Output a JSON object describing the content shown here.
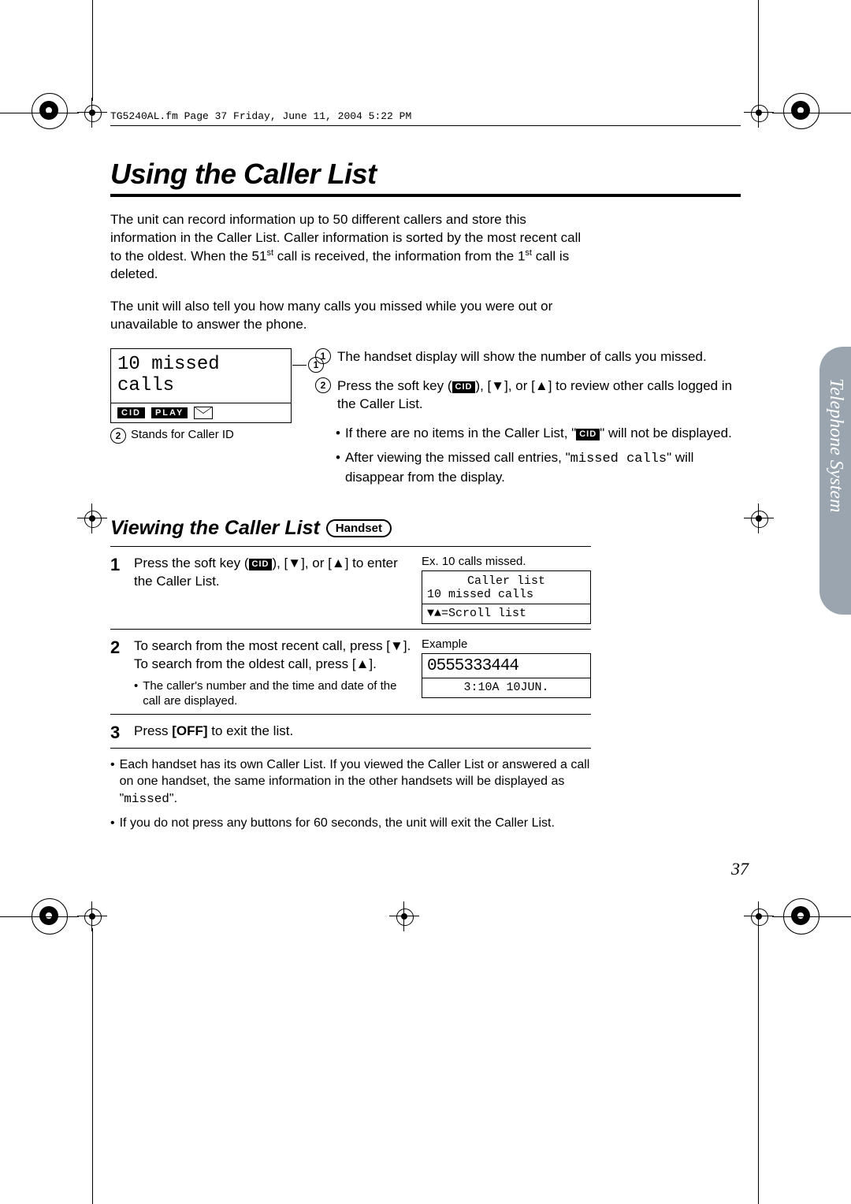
{
  "header": "TG5240AL.fm  Page 37  Friday, June 11, 2004  5:22 PM",
  "title": "Using the Caller List",
  "intro1_a": "The unit can record information up to 50 different callers and store this information in the Caller List. Caller information is sorted by the most recent call to the oldest. When the 51",
  "intro1_sup": "st",
  "intro1_b": " call is received, the information from the 1",
  "intro1_sup2": "st",
  "intro1_c": " call is deleted.",
  "intro2": "The unit will also tell you how many calls you missed while you were out or unavailable to answer the phone.",
  "lcd_top": "10 missed calls",
  "pill_cid": "CID",
  "pill_play": "PLAY",
  "stands_for": "Stands for Caller ID",
  "desc1": "The handset display will show the number of calls you missed.",
  "desc2_a": "Press the soft key (",
  "desc2_b": "), [",
  "desc2_c": "], or [",
  "desc2_d": "] to review other calls logged in the Caller List.",
  "desc2_bullet1_a": "If there are no items in the Caller List, \"",
  "desc2_bullet1_b": "\" will not be displayed.",
  "desc2_bullet2_a": "After viewing the missed call entries, \"",
  "desc2_bullet2_mono": "missed calls",
  "desc2_bullet2_b": "\" will disappear from the display.",
  "h2": "Viewing the Caller List",
  "handset_label": "Handset",
  "step1_a": "Press the soft key (",
  "step1_b": "), [",
  "step1_c": "], or [",
  "step1_d": "] to enter the Caller List.",
  "step1_ex_label": "Ex. 10 calls missed.",
  "step1_box_l1": "Caller list",
  "step1_box_l2": "10 missed calls",
  "step1_box_l3": "=Scroll list",
  "step2_a": "To search from the most recent call, press [",
  "step2_b": "]. To search from the oldest call, press [",
  "step2_c": "].",
  "step2_bullet": "The caller's number and the time and date of the call are displayed.",
  "step2_ex_label": "Example",
  "step2_box_num": "0555333444",
  "step2_box_time": "3:10A 10JUN.",
  "step3_a": "Press ",
  "step3_off": "[OFF]",
  "step3_b": " to exit the list.",
  "note1_a": "Each handset has its own Caller List. If you viewed the Caller List or answered a call on one handset, the same information in the other handsets will be displayed as \"",
  "note1_mono": "missed",
  "note1_b": "\".",
  "note2": "If you do not press any buttons for 60 seconds, the unit will exit the Caller List.",
  "page_number": "37",
  "side_tab": "Telephone System"
}
